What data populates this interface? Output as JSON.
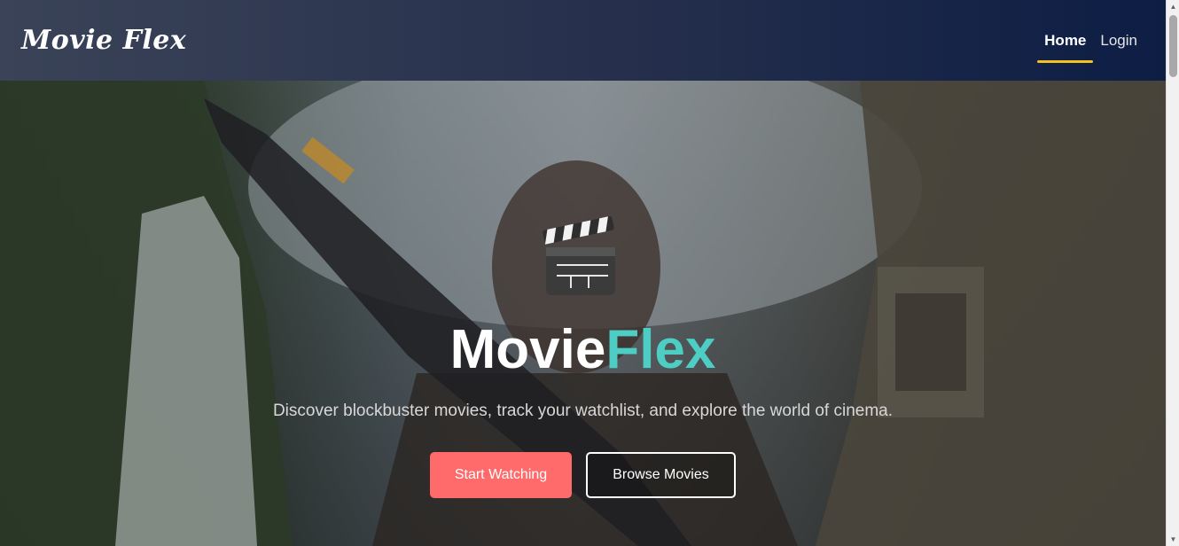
{
  "navbar": {
    "logo": "Movie Flex",
    "links": [
      {
        "label": "Home",
        "active": true
      },
      {
        "label": "Login",
        "active": false
      }
    ],
    "active_underline_color": "#f4c21f"
  },
  "hero": {
    "icon": "clapperboard-icon",
    "title_main": "Movie",
    "title_accent": "Flex",
    "title_accent_color": "#4ecdc4",
    "subtitle": "Discover blockbuster movies, track your watchlist, and explore the world of cinema.",
    "primary_button": "Start Watching",
    "primary_color": "#ff6b6b",
    "secondary_button": "Browse Movies"
  }
}
